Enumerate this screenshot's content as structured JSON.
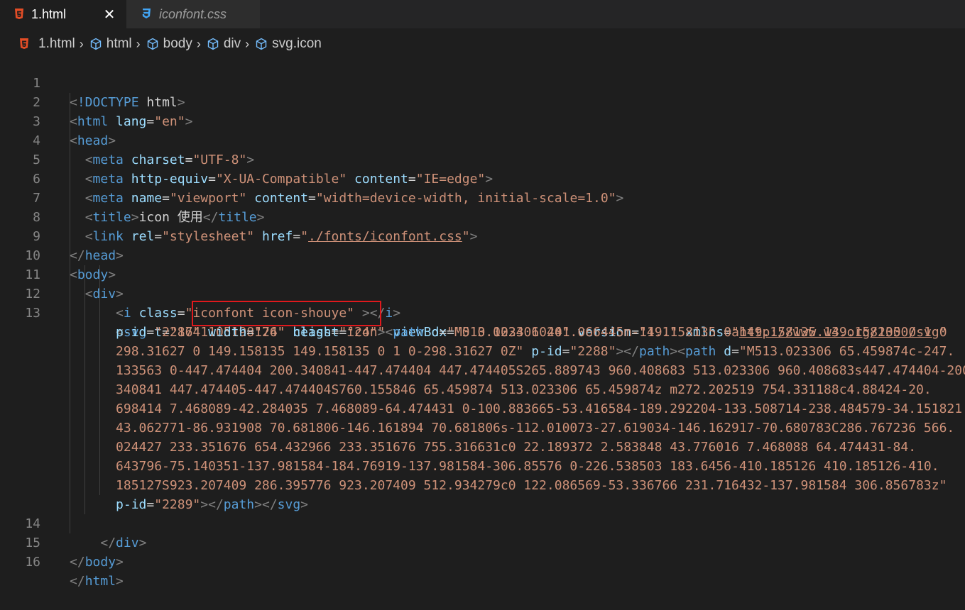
{
  "tabs": [
    {
      "label": "1.html",
      "icon": "html5-icon",
      "active": true
    },
    {
      "label": "iconfont.css",
      "icon": "css3-icon",
      "active": false
    }
  ],
  "breadcrumb": [
    "1.html",
    "html",
    "body",
    "div",
    "svg.icon"
  ],
  "colors": {
    "background": "#1e1e1e",
    "tag": "#569cd6",
    "attribute": "#9cdcfe",
    "string": "#ce9178",
    "highlight_box": "#e0191d"
  },
  "line_numbers": [
    "1",
    "2",
    "3",
    "4",
    "5",
    "6",
    "7",
    "8",
    "9",
    "10",
    "11",
    "12",
    "13",
    "14",
    "15",
    "16"
  ],
  "code": {
    "doctype": "!DOCTYPE",
    "doctype_html": "html",
    "html": "html",
    "lang_attr": "lang",
    "lang_val": "\"en\"",
    "head": "head",
    "meta": "meta",
    "charset_attr": "charset",
    "charset_val": "\"UTF-8\"",
    "http_equiv_attr": "http-equiv",
    "http_equiv_val": "\"X-UA-Compatible\"",
    "content_attr": "content",
    "content_val_edge": "\"IE=edge\"",
    "name_attr": "name",
    "name_val": "\"viewport\"",
    "content_val_viewport": "\"width=device-width, initial-scale=1.0\"",
    "title": "title",
    "title_text": "icon 使用",
    "link": "link",
    "rel_attr": "rel",
    "rel_val": "\"stylesheet\"",
    "href_attr": "href",
    "href_val": "./fonts/iconfont.css",
    "body": "body",
    "div": "div",
    "i": "i",
    "class_attr": "class",
    "i_class_val": "\"iconfont icon-shouye\"",
    "svg": "svg",
    "t_attr": "t",
    "t_val": "\"1641105198176\"",
    "svg_class_val": "\"icon\"",
    "viewbox_attr": "viewBox",
    "viewbox_val": "\"0 0 1024 1024\"",
    "version_attr": "version",
    "version_val": "\"1.1\"",
    "xmlns_attr": "xmlns",
    "xmlns_val": "http://www.w3.org/2000/svg",
    "pid_attr": "p-id",
    "pid_svg": "\"2287\"",
    "width_attr": "width",
    "width_val": "\"24\"",
    "height_attr": "height",
    "height_val": "\"24\"",
    "path": "path",
    "d_attr": "d",
    "path1_start": "\"M513.023306 401.066445m-149.158135 0a149.158135 149.158135 0 1 0",
    "path1_cont": "298.31627 0 149.158135 149.158135 0 1 0-298.31627 0Z\"",
    "pid_path1": "\"2288\"",
    "path2_start": "\"M513.023306 65.459874c-247.",
    "path2_l1": "133563 0-447.474404 200.340841-447.474404 447.474405S265.889743 960.408683 513.023306 960.408683s447.474404-200.",
    "path2_l2": "340841 447.474405-447.474404S760.155846 65.459874 513.023306 65.459874z m272.202519 754.331188c4.88424-20.",
    "path2_l3": "698414 7.468089-42.284035 7.468089-64.474431 0-100.883665-53.416584-189.292204-133.508714-238.484579-34.151821",
    "path2_l4": "43.062771-86.931908 70.681806-146.161894 70.681806s-112.010073-27.619034-146.162917-70.680783C286.767236 566.",
    "path2_l5": "024427 233.351676 654.432966 233.351676 755.316631c0 22.189372 2.583848 43.776016 7.468088 64.474431-84.",
    "path2_l6": "643796-75.140351-137.981584-184.76919-137.981584-306.85576 0-226.538503 183.6456-410.185126 410.185126-410.",
    "path2_l7": "185127S923.207409 286.395776 923.207409 512.934279c0 122.086569-53.336766 231.716432-137.981584 306.856783z\"",
    "pid_path2": "\"2289\""
  }
}
